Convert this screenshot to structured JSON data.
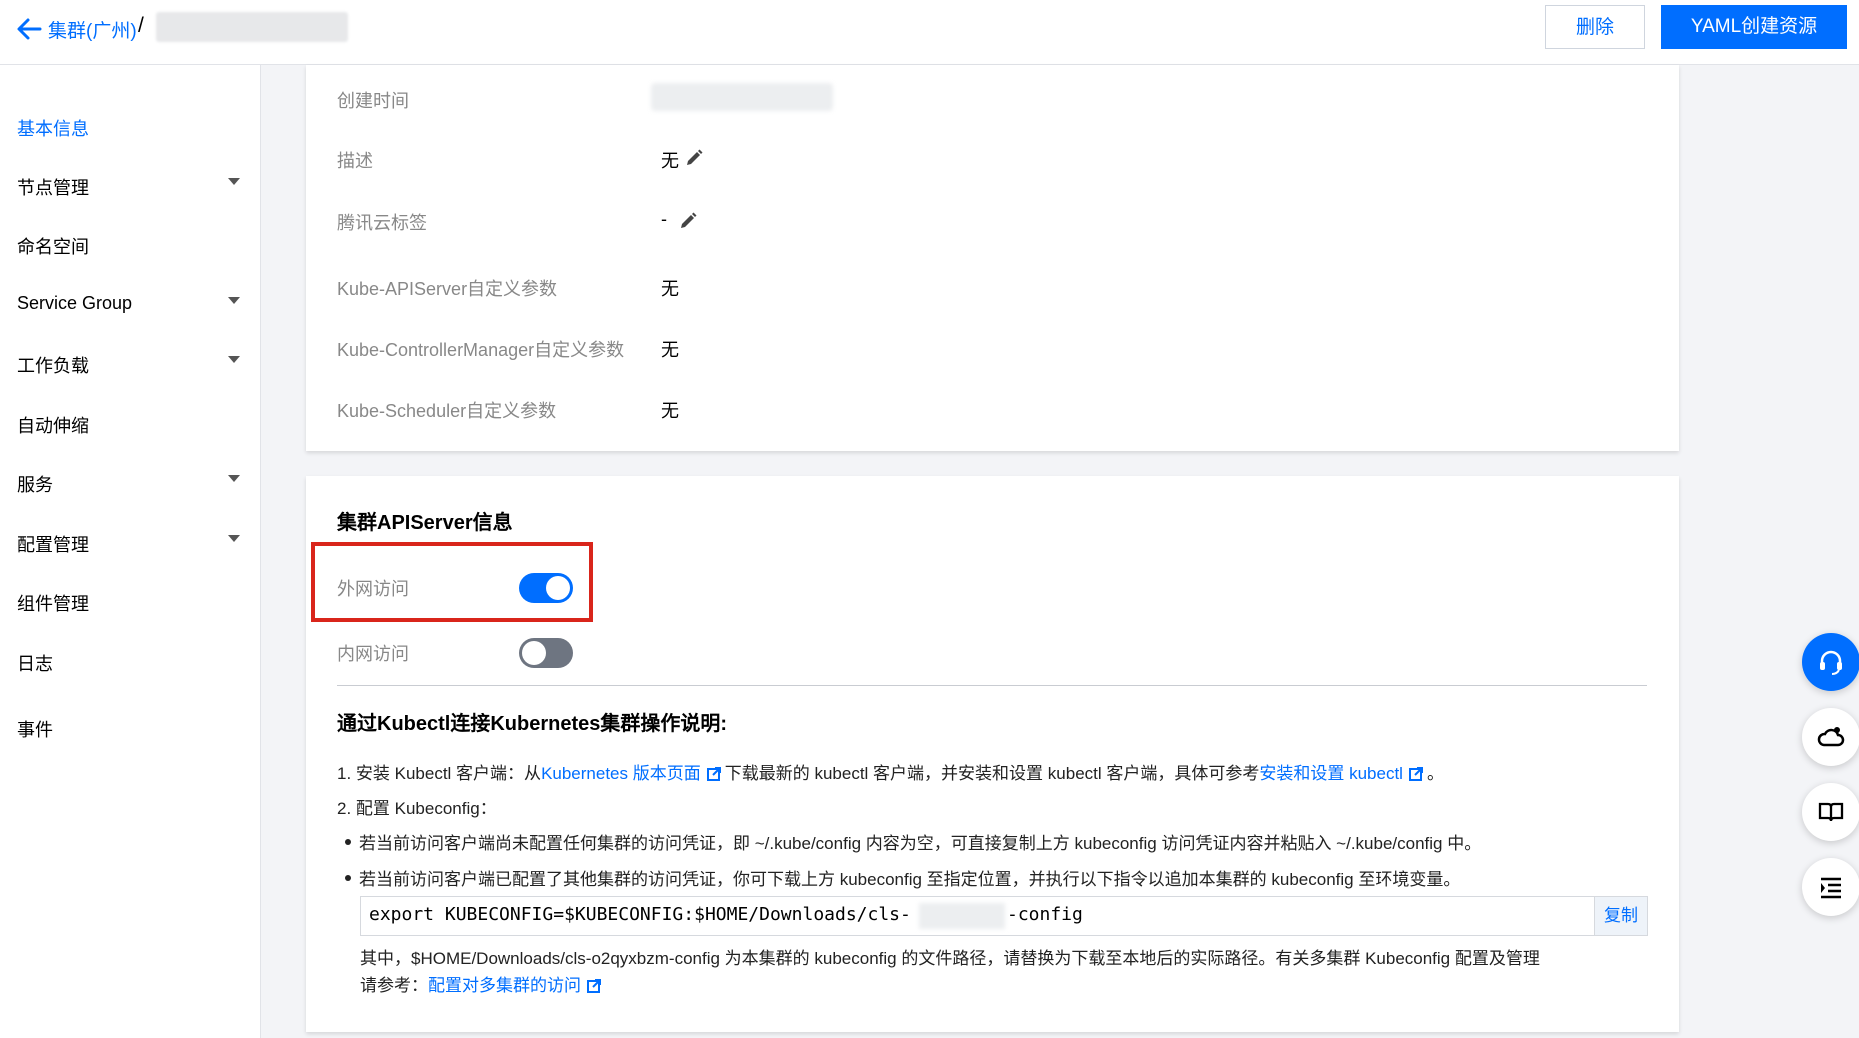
{
  "header": {
    "breadcrumb_parent": "集群(广州)",
    "breadcrumb_sep": "/",
    "delete_label": "删除",
    "yaml_label": "YAML创建资源"
  },
  "sidebar": {
    "items": [
      {
        "label": "基本信息",
        "active": true
      },
      {
        "label": "节点管理",
        "expandable": true
      },
      {
        "label": "命名空间"
      },
      {
        "label": "Service Group",
        "expandable": true
      },
      {
        "label": "工作负载",
        "expandable": true
      },
      {
        "label": "自动伸缩"
      },
      {
        "label": "服务",
        "expandable": true
      },
      {
        "label": "配置管理",
        "expandable": true
      },
      {
        "label": "组件管理"
      },
      {
        "label": "日志"
      },
      {
        "label": "事件"
      }
    ]
  },
  "info": {
    "created_label": "创建时间",
    "desc_label": "描述",
    "desc_value": "无",
    "tags_label": "腾讯云标签",
    "tags_value": "-",
    "apiserver_label": "Kube-APIServer自定义参数",
    "apiserver_value": "无",
    "cm_label": "Kube-ControllerManager自定义参数",
    "cm_value": "无",
    "scheduler_label": "Kube-Scheduler自定义参数",
    "scheduler_value": "无"
  },
  "apiserver": {
    "title": "集群APIServer信息",
    "external_label": "外网访问",
    "external_on": true,
    "internal_label": "内网访问",
    "internal_on": false
  },
  "guide": {
    "title": "通过Kubectl连接Kubernetes集群操作说明:",
    "step1_prefix": "1. 安装 Kubectl 客户端：从",
    "step1_link1": "Kubernetes 版本页面",
    "step1_mid": "下载最新的 kubectl 客户端，并安装和设置 kubectl 客户端，具体可参考",
    "step1_link2": "安装和设置 kubectl",
    "step1_suffix": "。",
    "step2": "2. 配置 Kubeconfig：",
    "bullet1": "若当前访问客户端尚未配置任何集群的访问凭证，即 ~/.kube/config 内容为空，可直接复制上方 kubeconfig 访问凭证内容并粘贴入 ~/.kube/config 中。",
    "bullet2": "若当前访问客户端已配置了其他集群的访问凭证，你可下载上方 kubeconfig 至指定位置，并执行以下指令以追加本集群的 kubeconfig 至环境变量。",
    "code_prefix": "export KUBECONFIG=$KUBECONFIG:$HOME/Downloads/cls-",
    "code_suffix": "-config",
    "copy_label": "复制",
    "note_line1": "其中，$HOME/Downloads/cls-o2qyxbzm-config 为本集群的 kubeconfig 的文件路径，请替换为下载至本地后的实际路径。有关多集群 Kubeconfig 配置及管理",
    "note_prefix": "请参考：",
    "note_link": "配置对多集群的访问"
  },
  "floating": [
    "headset-icon",
    "cloud-icon",
    "book-icon",
    "list-icon"
  ],
  "colors": {
    "accent": "#006eff",
    "highlight": "#d9251b"
  }
}
